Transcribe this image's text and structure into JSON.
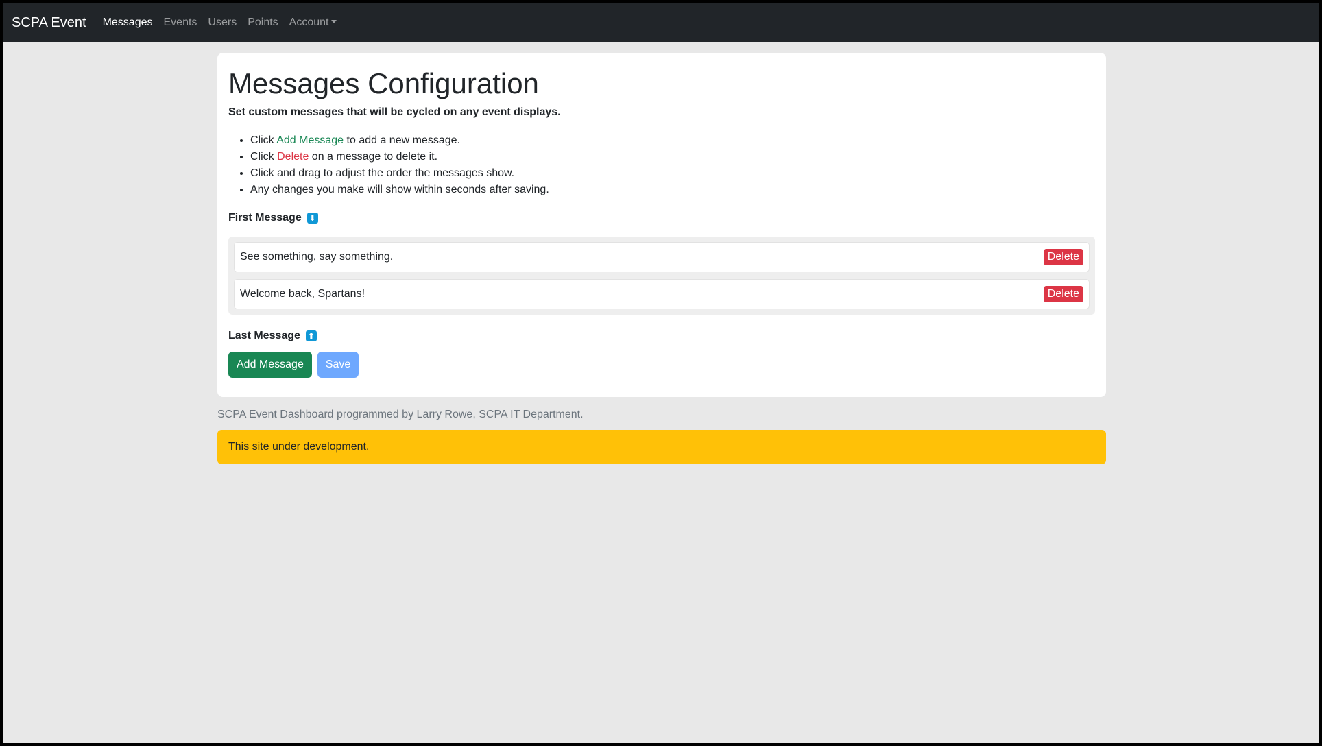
{
  "nav": {
    "brand": "SCPA Event",
    "items": [
      {
        "label": "Messages"
      },
      {
        "label": "Events"
      },
      {
        "label": "Users"
      },
      {
        "label": "Points"
      },
      {
        "label": "Account"
      }
    ]
  },
  "page": {
    "title": "Messages Configuration",
    "subtitle": "Set custom messages that will be cycled on any event displays.",
    "instructions": [
      {
        "pre": "Click ",
        "link": "Add Message",
        "post": " to add a new message."
      },
      {
        "pre": "Click ",
        "link": "Delete",
        "post": " on a message to delete it."
      },
      {
        "text": "Click and drag to adjust the order the messages show."
      },
      {
        "text": "Any changes you make will show within seconds after saving."
      }
    ],
    "first_label": "First Message",
    "last_label": "Last Message",
    "arrow_down": "⬇",
    "arrow_up": "⬆",
    "messages": [
      {
        "text": "See something, say something.",
        "delete_label": "Delete"
      },
      {
        "text": "Welcome back, Spartans!",
        "delete_label": "Delete"
      }
    ],
    "add_button": "Add Message",
    "save_button": "Save"
  },
  "footer": "SCPA Event Dashboard programmed by Larry Rowe, SCPA IT Department.",
  "alert": "This site under development.",
  "colors": {
    "navbar": "#212529",
    "success": "#198754",
    "danger": "#dc3545",
    "warning": "#ffc107",
    "primary_disabled": "#6ea8fe",
    "info_icon": "#1098d6"
  }
}
